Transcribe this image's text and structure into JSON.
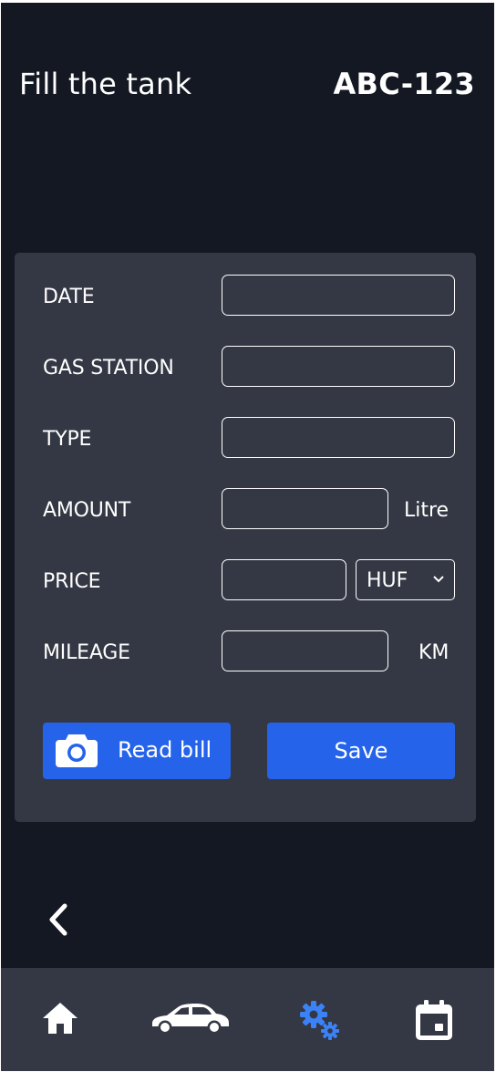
{
  "header": {
    "title": "Fill the tank",
    "plate": "ABC-123"
  },
  "form": {
    "date": {
      "label": "DATE",
      "value": ""
    },
    "gas_station": {
      "label": "GAS STATION",
      "value": ""
    },
    "type": {
      "label": "TYPE",
      "value": ""
    },
    "amount": {
      "label": "AMOUNT",
      "value": "",
      "unit": "Litre"
    },
    "price": {
      "label": "PRICE",
      "value": "",
      "currency": "HUF"
    },
    "mileage": {
      "label": "MILEAGE",
      "value": "",
      "unit": "KM"
    }
  },
  "actions": {
    "read_bill": "Read bill",
    "save": "Save"
  },
  "nav": {
    "back_icon": "chevron-left-icon",
    "tabs": [
      {
        "icon": "home-icon"
      },
      {
        "icon": "car-icon"
      },
      {
        "icon": "gears-icon",
        "active": true
      },
      {
        "icon": "calendar-icon"
      }
    ]
  },
  "colors": {
    "background": "#141822",
    "card": "#343844",
    "accent": "#2563eb",
    "active_tab": "#3b82f6",
    "text": "#ffffff"
  }
}
